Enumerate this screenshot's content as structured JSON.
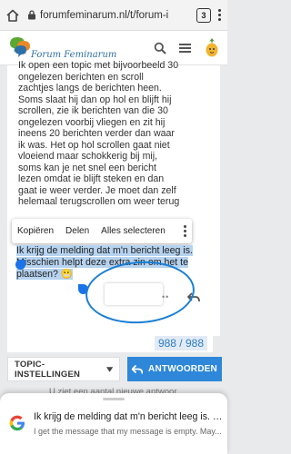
{
  "browser": {
    "url": "forumfeminarum.nl/t/forum-i",
    "tab_count": "3"
  },
  "header": {
    "site_name": "Forum Feminarum"
  },
  "post": {
    "lines": [
      "Ik open een topic met bijvoorbeeld 30",
      "ongelezen berichten en scroll",
      "zachtjes langs de berichten heen.",
      "Soms slaat hij dan op hol en blijft hij",
      "scrollen, zie ik berichten van die 30",
      "ongelezen voorbij vliegen en zit hij",
      "ineens 20 berichten verder dan waar",
      "ik was. Het op hol scrollen gaat niet",
      "vloeiend maar schokkerig bij mij,",
      "soms kan je net snel een bericht",
      "lezen omdat ie blijft steken en dan",
      "gaat ie weer verder. Je moet dan zelf",
      "helemaal terugscrollen om weer terug"
    ]
  },
  "selection_menu": {
    "copy": "Kopiëren",
    "share": "Delen",
    "select_all": "Alles selecteren"
  },
  "quote": {
    "line1": "Ik krijg de melding dat m'n bericht leeg is.",
    "line2": "Misschien helpt deze extra zin om het te",
    "line3": "plaatsen? 😬"
  },
  "counter": {
    "value": "988 / 988"
  },
  "buttons": {
    "topic_settings": "TOPIC-INSTELLINGEN",
    "reply": "ANTWOORDEN"
  },
  "notice": "U ziet een aantal nieuwe antwoor",
  "google_card": {
    "title": "Ik krijg de melding dat m'n bericht leeg is. M...",
    "subtitle": "I get the message that my message is empty. May..."
  },
  "colors": {
    "accent": "#2e87d8",
    "selection": "#b6d3f0",
    "circle": "#1a7fd4"
  }
}
